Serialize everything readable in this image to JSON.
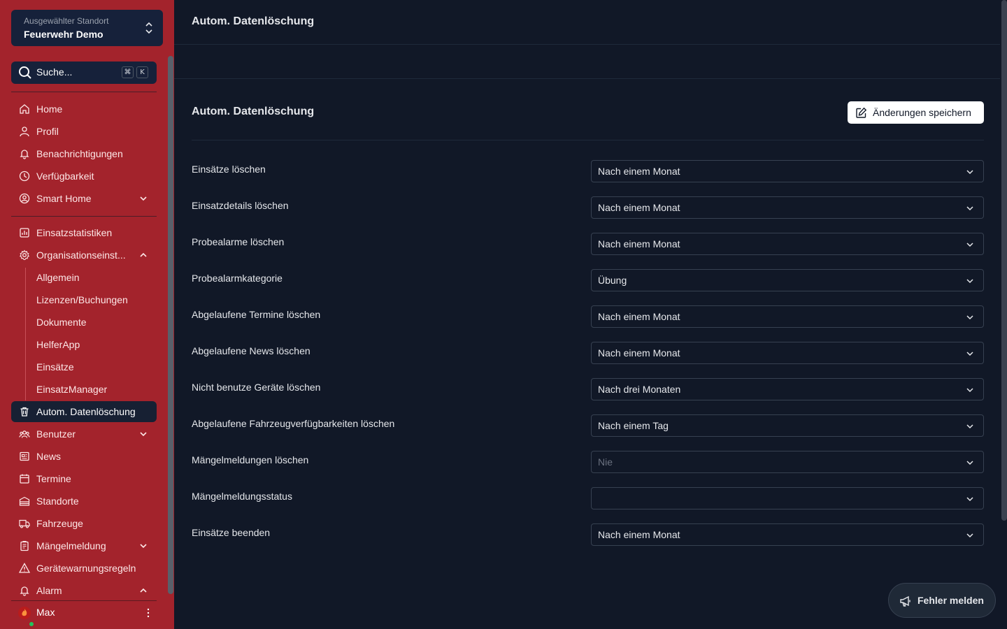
{
  "location": {
    "label": "Ausgewählter Standort",
    "value": "Feuerwehr Demo"
  },
  "search": {
    "placeholder": "Suche...",
    "key1": "⌘",
    "key2": "K"
  },
  "sidebar": {
    "items": [
      {
        "label": "Home",
        "icon": "home-icon"
      },
      {
        "label": "Profil",
        "icon": "user-icon"
      },
      {
        "label": "Benachrichtigungen",
        "icon": "bell-icon"
      },
      {
        "label": "Verfügbarkeit",
        "icon": "clock-icon"
      },
      {
        "label": "Smart Home",
        "icon": "user-circle-icon"
      },
      {
        "label": "Einsatzstatistiken",
        "icon": "chart-icon"
      },
      {
        "label": "Organisationseinst...",
        "icon": "gear-icon"
      },
      {
        "label": "Allgemein"
      },
      {
        "label": "Lizenzen/Buchungen"
      },
      {
        "label": "Dokumente"
      },
      {
        "label": "HelferApp"
      },
      {
        "label": "Einsätze"
      },
      {
        "label": "EinsatzManager"
      },
      {
        "label": "Autom. Datenlöschung",
        "icon": "trash-icon"
      },
      {
        "label": "Benutzer",
        "icon": "users-icon"
      },
      {
        "label": "News",
        "icon": "newspaper-icon"
      },
      {
        "label": "Termine",
        "icon": "calendar-icon"
      },
      {
        "label": "Standorte",
        "icon": "building-icon"
      },
      {
        "label": "Fahrzeuge",
        "icon": "truck-icon"
      },
      {
        "label": "Mängelmeldung",
        "icon": "clipboard-icon"
      },
      {
        "label": "Gerätewarnungsregeln",
        "icon": "warning-icon"
      },
      {
        "label": "Alarm",
        "icon": "bell-icon"
      }
    ],
    "user": "Max"
  },
  "page": {
    "title": "Autom. Datenlöschung",
    "section_title": "Autom. Datenlöschung",
    "save_label": "Änderungen speichern",
    "report_label": "Fehler melden"
  },
  "settings": [
    {
      "label": "Einsätze löschen",
      "value": "Nach einem Monat"
    },
    {
      "label": "Einsatzdetails löschen",
      "value": "Nach einem Monat"
    },
    {
      "label": "Probealarme löschen",
      "value": "Nach einem Monat"
    },
    {
      "label": "Probealarmkategorie",
      "value": "Übung"
    },
    {
      "label": "Abgelaufene Termine löschen",
      "value": "Nach einem Monat"
    },
    {
      "label": "Abgelaufene News löschen",
      "value": "Nach einem Monat"
    },
    {
      "label": "Nicht benutze Geräte löschen",
      "value": "Nach drei Monaten"
    },
    {
      "label": "Abgelaufene Fahrzeugverfügbarkeiten löschen",
      "value": "Nach einem Tag"
    },
    {
      "label": "Mängelmeldungen löschen",
      "value": "Nie"
    },
    {
      "label": "Mängelmeldungsstatus",
      "value": ""
    },
    {
      "label": "Einsätze beenden",
      "value": "Nach einem Monat"
    }
  ],
  "colors": {
    "sidebar": "#a3232c",
    "background": "#111827",
    "active": "#172033"
  }
}
